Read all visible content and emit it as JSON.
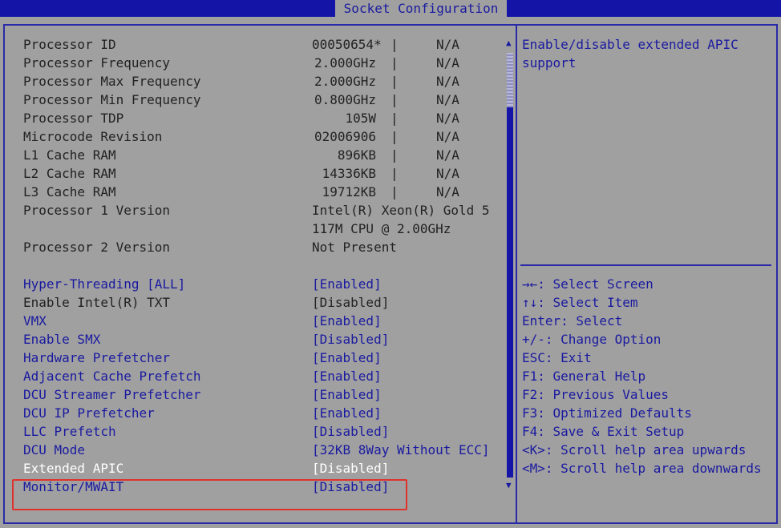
{
  "header": {
    "title": "Socket Configuration"
  },
  "info_rows": [
    {
      "label": "Processor ID",
      "value": "00050654*",
      "sep": "|",
      "na": "N/A"
    },
    {
      "label": "Processor Frequency",
      "value": "2.000GHz",
      "sep": "|",
      "na": "N/A"
    },
    {
      "label": "Processor Max Frequency",
      "value": "2.000GHz",
      "sep": "|",
      "na": "N/A"
    },
    {
      "label": "Processor Min Frequency",
      "value": "0.800GHz",
      "sep": "|",
      "na": "N/A"
    },
    {
      "label": "Processor TDP",
      "value": "105W",
      "sep": "|",
      "na": "N/A"
    },
    {
      "label": "Microcode Revision",
      "value": "02006906",
      "sep": "|",
      "na": "N/A"
    },
    {
      "label": "L1 Cache RAM",
      "value": "896KB",
      "sep": "|",
      "na": "N/A"
    },
    {
      "label": "L2 Cache RAM",
      "value": "14336KB",
      "sep": "|",
      "na": "N/A"
    },
    {
      "label": "L3 Cache RAM",
      "value": "19712KB",
      "sep": "|",
      "na": "N/A"
    }
  ],
  "proc1": {
    "label": "Processor 1 Version",
    "value_line1": "Intel(R) Xeon(R) Gold 5",
    "value_line2": "117M CPU @ 2.00GHz"
  },
  "proc2": {
    "label": "Processor 2 Version",
    "value": "Not Present"
  },
  "settings": [
    {
      "label": "Hyper-Threading [ALL]",
      "value": "[Enabled]"
    },
    {
      "label": "Enable Intel(R) TXT",
      "value": "[Disabled]"
    },
    {
      "label": "VMX",
      "value": "[Enabled]"
    },
    {
      "label": "Enable SMX",
      "value": "[Disabled]"
    },
    {
      "label": "Hardware Prefetcher",
      "value": "[Enabled]"
    },
    {
      "label": "Adjacent Cache Prefetch",
      "value": "[Enabled]"
    },
    {
      "label": "DCU Streamer Prefetcher",
      "value": "[Enabled]"
    },
    {
      "label": "DCU IP Prefetcher",
      "value": "[Enabled]"
    },
    {
      "label": "LLC Prefetch",
      "value": "[Disabled]"
    },
    {
      "label": "DCU Mode",
      "value": "[32KB 8Way Without ECC]"
    },
    {
      "label": "Extended APIC",
      "value": "[Disabled]"
    },
    {
      "label": "Monitor/MWAIT",
      "value": "[Disabled]"
    }
  ],
  "help": {
    "line1": "Enable/disable extended APIC",
    "line2": "support"
  },
  "keys": [
    "→←: Select Screen",
    "↑↓: Select Item",
    "Enter: Select",
    "+/-: Change Option",
    "ESC: Exit",
    "F1: General Help",
    "F2: Previous Values",
    "F3: Optimized Defaults",
    "F4: Save & Exit Setup",
    "<K>: Scroll help area upwards",
    "<M>: Scroll help area downwards"
  ],
  "scroll": {
    "up_arrow": "▲",
    "down_arrow": "▼"
  },
  "colors": {
    "accent": "#1414a6",
    "background": "#a0a0a0",
    "highlight_box": "#e0322c",
    "selected_text": "#ffffff"
  }
}
